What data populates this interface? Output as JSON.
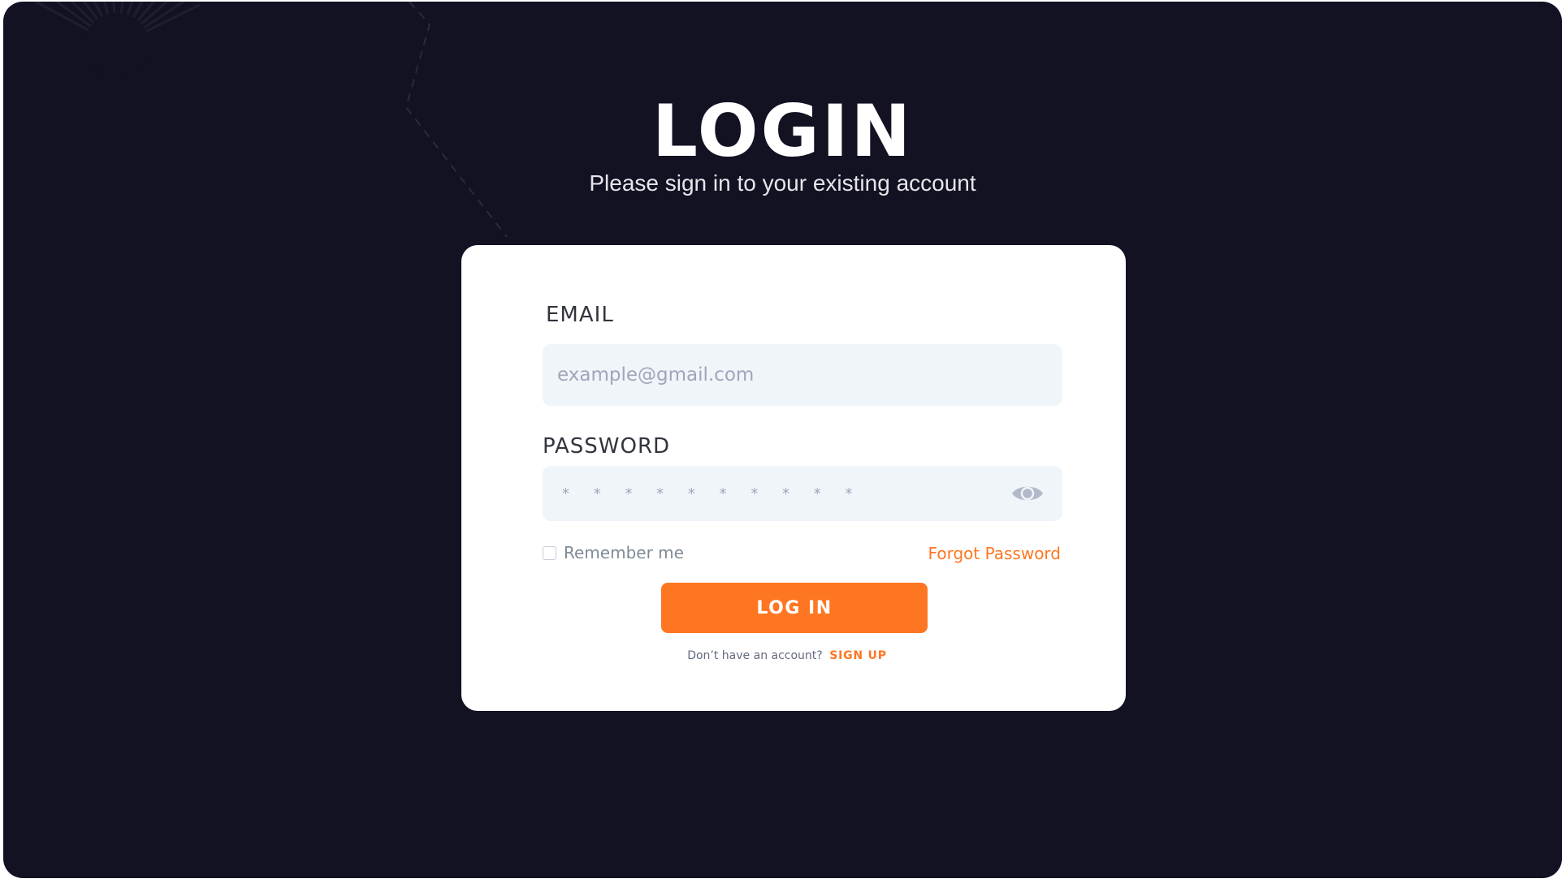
{
  "header": {
    "title": "LOGIN",
    "subtitle": "Please sign in to your existing account"
  },
  "form": {
    "email": {
      "label": "EMAIL",
      "placeholder": "example@gmail.com",
      "value": ""
    },
    "password": {
      "label": "PASSWORD",
      "masked_value": "* * * * * * * * * *",
      "toggle_icon": "eye-icon"
    },
    "remember_me": {
      "label": "Remember me",
      "checked": false
    },
    "forgot_password_label": "Forgot Password",
    "submit_label": "LOG IN",
    "signup_prompt": "Don’t have an account?",
    "signup_label": "SIGN UP"
  },
  "colors": {
    "background": "#121223",
    "card": "#ffffff",
    "accent": "#ff7622",
    "field_background": "#f0f5fa",
    "label_text": "#32343e",
    "placeholder_text": "#a0a5ba"
  }
}
